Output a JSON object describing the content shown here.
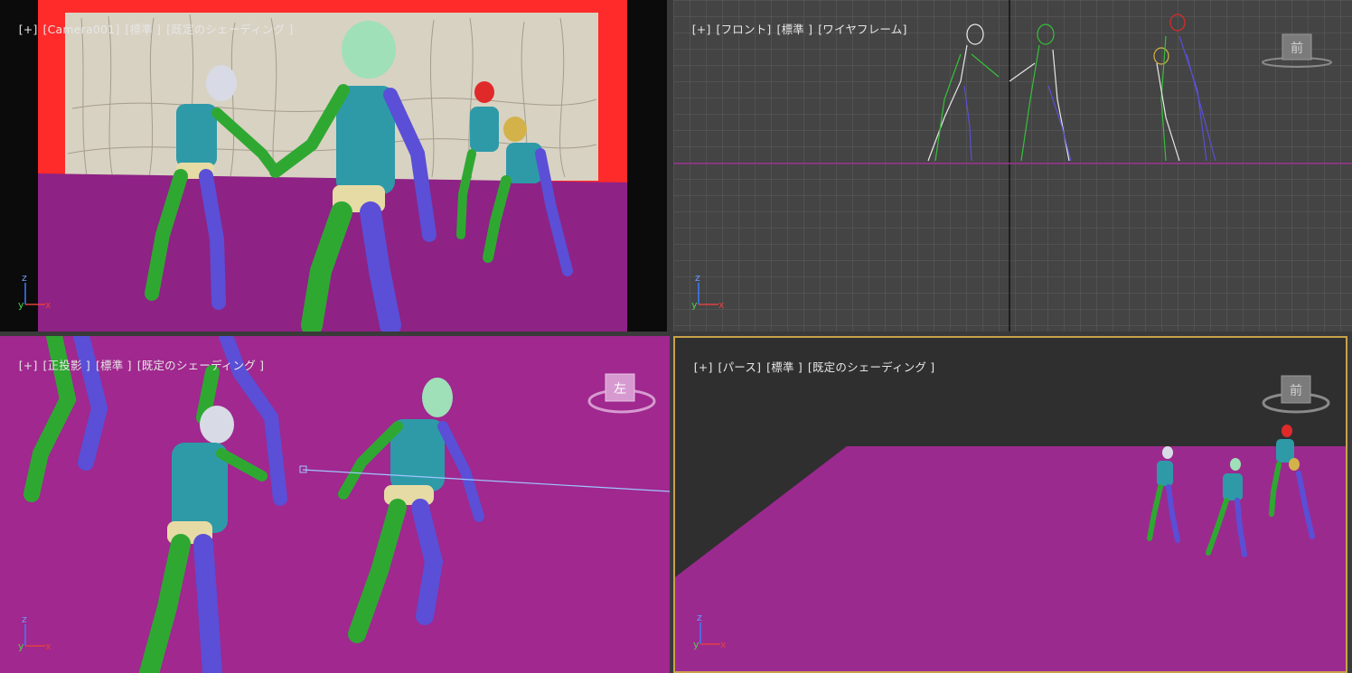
{
  "viewports": {
    "camera": {
      "labels": [
        "[+]",
        "[Camera001]",
        "[標準 ]",
        "[既定のシェーディング ]"
      ]
    },
    "front": {
      "labels": [
        "[+]",
        "[フロント]",
        "[標準 ]",
        "[ワイヤフレーム]"
      ],
      "viewcube": "前"
    },
    "ortho": {
      "labels": [
        "[+]",
        "[正投影 ]",
        "[標準 ]",
        "[既定のシェーディング ]"
      ],
      "viewcube": "左"
    },
    "persp": {
      "labels": [
        "[+]",
        "[パース]",
        "[標準 ]",
        "[既定のシェーディング ]"
      ],
      "viewcube": "前"
    }
  },
  "axis": {
    "z": "z",
    "y": "y",
    "x": "x"
  },
  "colors": {
    "floor": "#9b2a8f",
    "safe_frame": "#ff2a2a",
    "active_border": "#c9a24a",
    "limb_green": "#2fa832",
    "limb_blue": "#5a4fd6",
    "torso_teal": "#2e9aa8",
    "pelvis_tan": "#e6dba4"
  }
}
